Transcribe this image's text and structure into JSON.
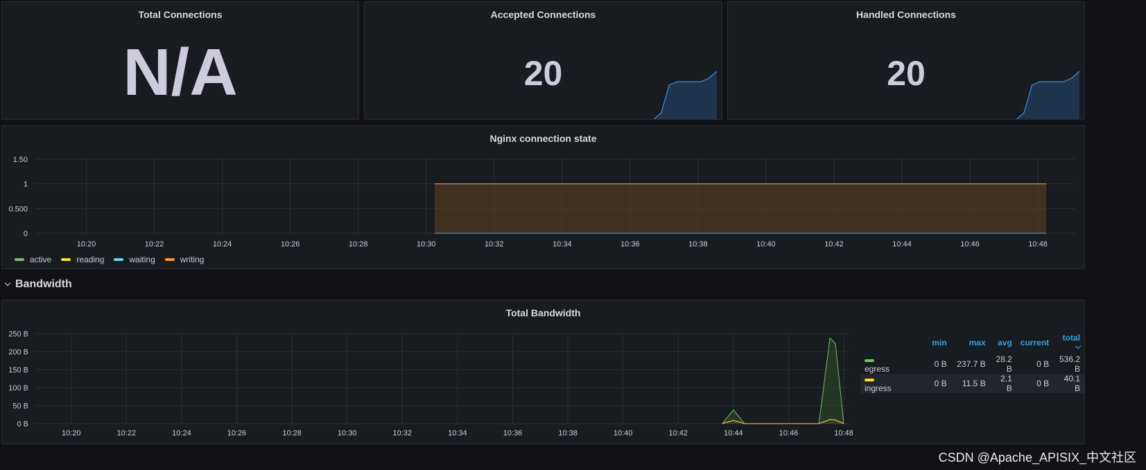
{
  "stats": [
    {
      "title": "Total Connections",
      "value": "N/A",
      "spark": null
    },
    {
      "title": "Accepted Connections",
      "value": "20",
      "spark": [
        0,
        0,
        0,
        0,
        0,
        0,
        0,
        0,
        0,
        0,
        0,
        0,
        0,
        0,
        0,
        0,
        0,
        0,
        0,
        0.2,
        1,
        1.1,
        1.1,
        1.1,
        1.1,
        1.2,
        1.4
      ]
    },
    {
      "title": "Handled Connections",
      "value": "20",
      "spark": [
        0,
        0,
        0,
        0,
        0,
        0,
        0,
        0,
        0,
        0,
        0,
        0,
        0,
        0,
        0,
        0,
        0,
        0,
        0,
        0.2,
        1,
        1.1,
        1.1,
        1.1,
        1.1,
        1.2,
        1.4
      ]
    }
  ],
  "connection_chart": {
    "title": "Nginx connection state",
    "y_ticks": [
      "1.50",
      "1",
      "0.500",
      "0"
    ],
    "x_ticks": [
      "10:20",
      "10:22",
      "10:24",
      "10:26",
      "10:28",
      "10:30",
      "10:32",
      "10:34",
      "10:36",
      "10:38",
      "10:40",
      "10:42",
      "10:44",
      "10:46",
      "10:48"
    ],
    "legend": [
      {
        "name": "active",
        "color": "#73bf69"
      },
      {
        "name": "reading",
        "color": "#fade2a"
      },
      {
        "name": "waiting",
        "color": "#5794f2"
      },
      {
        "name": "writing",
        "color": "#ff9830"
      }
    ]
  },
  "row": {
    "title": "Bandwidth"
  },
  "bandwidth_chart": {
    "title": "Total Bandwidth",
    "y_ticks": [
      "250 B",
      "200 B",
      "150 B",
      "100 B",
      "50 B",
      "0 B"
    ],
    "x_ticks": [
      "10:20",
      "10:22",
      "10:24",
      "10:26",
      "10:28",
      "10:30",
      "10:32",
      "10:34",
      "10:36",
      "10:38",
      "10:40",
      "10:42",
      "10:44",
      "10:46",
      "10:48"
    ],
    "legend_headers": [
      "min",
      "max",
      "avg",
      "current",
      "total"
    ],
    "legend_rows": [
      {
        "name": "egress",
        "color": "#73bf69",
        "min": "0 B",
        "max": "237.7 B",
        "avg": "28.2 B",
        "current": "0 B",
        "total": "536.2 B"
      },
      {
        "name": "ingress",
        "color": "#fade2a",
        "min": "0 B",
        "max": "11.5 B",
        "avg": "2.1 B",
        "current": "0 B",
        "total": "40.1 B"
      }
    ]
  },
  "chart_data": [
    {
      "type": "area",
      "title": "Nginx connection state",
      "x": [
        "10:30",
        "10:48"
      ],
      "series": [
        {
          "name": "active",
          "values": [
            0,
            0
          ]
        },
        {
          "name": "reading",
          "values": [
            0,
            0
          ]
        },
        {
          "name": "waiting",
          "values": [
            0,
            0
          ]
        },
        {
          "name": "writing",
          "values": [
            1,
            1
          ]
        }
      ],
      "ylim": [
        0,
        1.5
      ],
      "legend": "bottom-left",
      "grid": true
    },
    {
      "type": "area",
      "title": "Total Bandwidth",
      "x": [
        "10:43.6",
        "10:44",
        "10:44.4",
        "10:47.1",
        "10:47.5",
        "10:47.7",
        "10:48"
      ],
      "series": [
        {
          "name": "egress",
          "values": [
            0,
            38,
            0,
            0,
            237.7,
            222,
            0
          ]
        },
        {
          "name": "ingress",
          "values": [
            0,
            9,
            0,
            0,
            11.5,
            10,
            0
          ]
        }
      ],
      "ylim": [
        0,
        250
      ],
      "legend": "right",
      "grid": true
    }
  ],
  "watermark": "CSDN @Apache_APISIX_中文社区"
}
